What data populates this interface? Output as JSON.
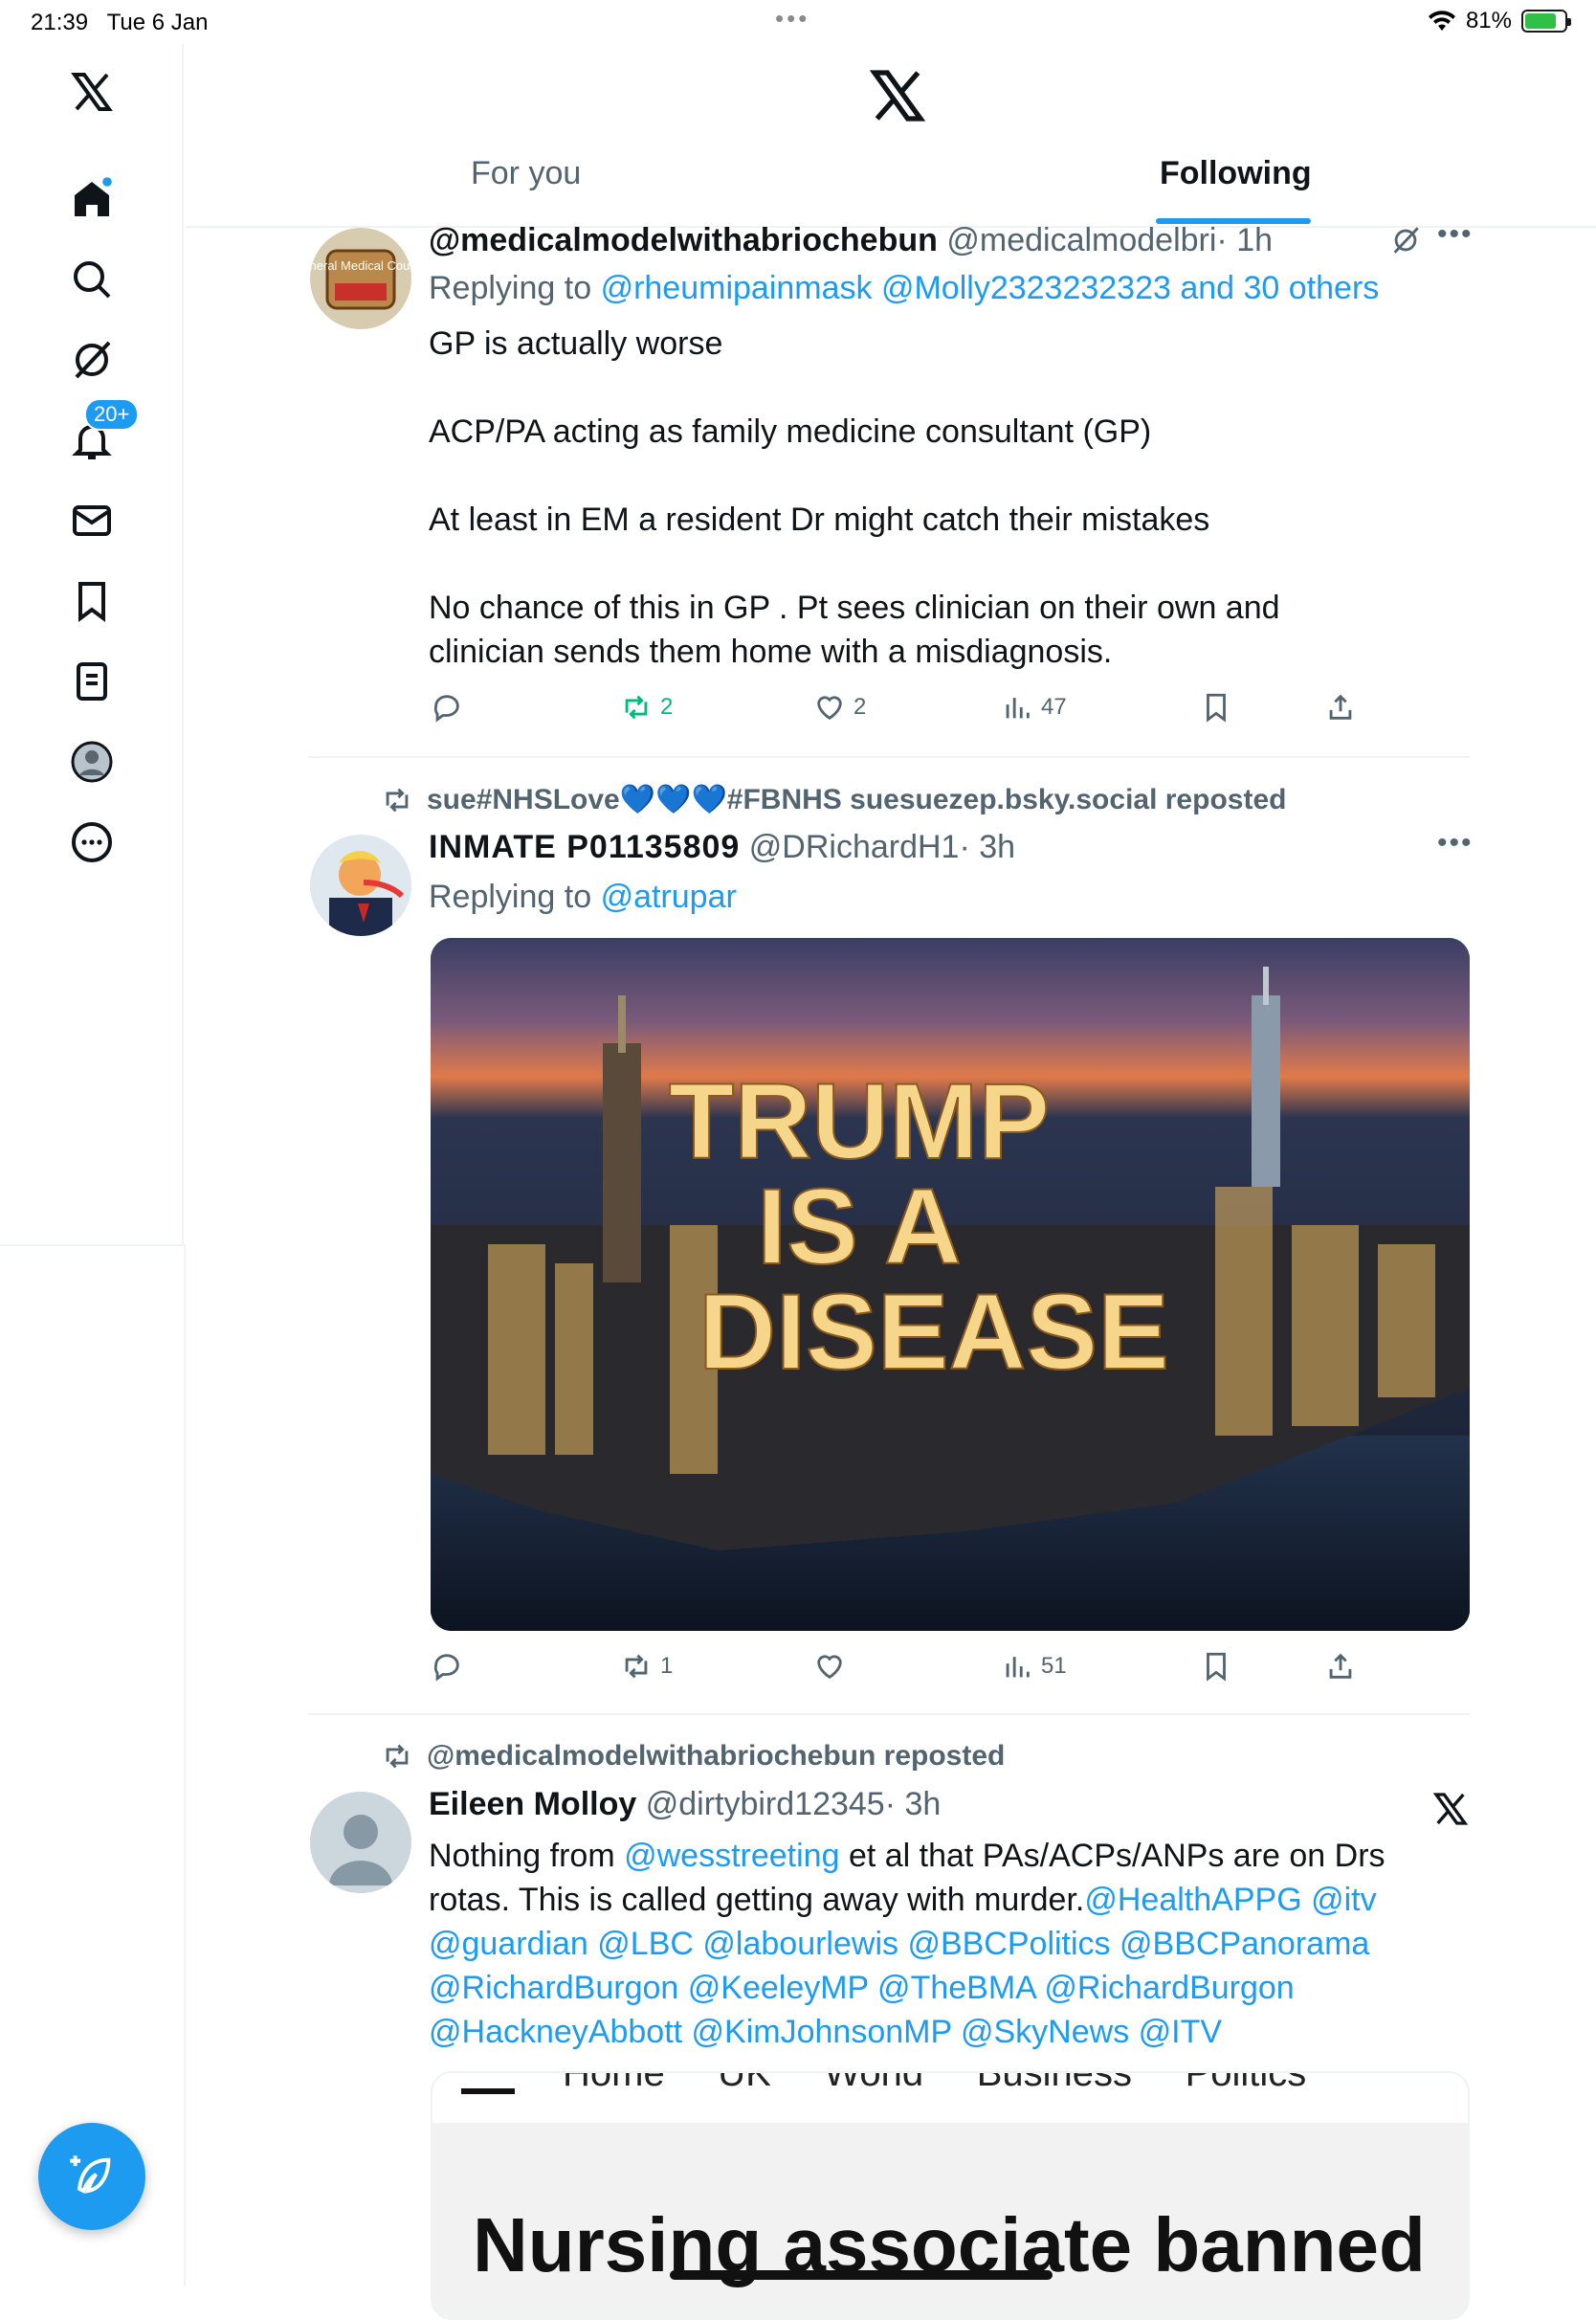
{
  "status_bar": {
    "time": "21:39",
    "date": "Tue 6 Jan",
    "battery": "81%",
    "more_dots": "•••"
  },
  "header": {
    "tabs": [
      {
        "label": "For you"
      },
      {
        "label": "Following"
      }
    ]
  },
  "sidebar": {
    "notifications_badge": "20+"
  },
  "tweets": [
    {
      "display_name": "@medicalmodelwithabriochebun",
      "handle": "@medicalmodelbri",
      "time": "· 1h",
      "replying_prefix": "Replying to",
      "replying_to": "@rheumipainmask @Molly2323232323 and 30 others",
      "paragraphs": [
        "GP is actually worse",
        "ACP/PA acting as family medicine consultant (GP)",
        "At least in EM a resident Dr might catch their mistakes",
        "No chance of this in GP . Pt sees clinician on their own and clinician sends them home with a misdiagnosis."
      ],
      "reposts": "2",
      "likes": "2",
      "views": "47",
      "avatar_text": "General Medical Council"
    },
    {
      "reposted_by": "sue#NHSLove💙💙💙#FBNHS suesuezep.bsky.social reposted",
      "display_name": "INMATE P01135809",
      "handle": "@DRichardH1",
      "time": "· 3h",
      "replying_prefix": "Replying to",
      "replying_to": "@atrupar",
      "image_lines": [
        "TRUMP",
        "IS A",
        "DISEASE"
      ],
      "reposts": "1",
      "likes": "",
      "views": "51"
    },
    {
      "reposted_by": "@medicalmodelwithabriochebun reposted",
      "display_name": "Eileen Molloy",
      "handle": "@dirtybird12345",
      "time": "· 3h",
      "text_prefix": "Nothing from",
      "mention_1": "@wesstreeting",
      "text_mid": "et al that PAs/ACPs/ANPs are on Drs rotas. This is called getting away with murder.",
      "mentions_line": "@HealthAPPG @itv @guardian @LBC @labourlewis @BBCPolitics @BBCPanorama @RichardBurgon @KeeleyMP @TheBMA @RichardBurgon @HackneyAbbott @KimJohnsonMP  @SkyNews @ITV",
      "card_nav": "Home     UK     World     Business     Politics",
      "card_headline": "Nursing associate banned"
    }
  ],
  "colors": {
    "accent": "#1d9bf0",
    "repost_active": "#00ba7c",
    "muted": "#536471"
  }
}
